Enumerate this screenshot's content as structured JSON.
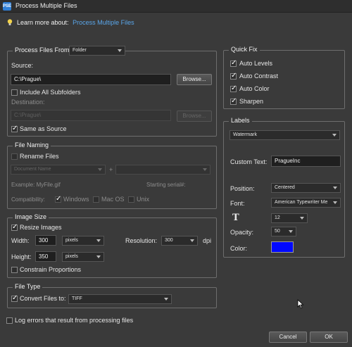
{
  "window": {
    "title": "Process Multiple Files",
    "app_icon_text": "PSE"
  },
  "learn_more": {
    "prefix": "Learn more about:",
    "link": "Process Multiple Files"
  },
  "process_from": {
    "legend": "Process Files From:",
    "value": "Folder",
    "source_label": "Source:",
    "source_path": "C:\\Prague\\",
    "browse_label": "Browse...",
    "include_subfolders": "Include All Subfolders",
    "destination_label": "Destination:",
    "destination_path": "C:\\Prague\\",
    "browse2_label": "Browse...",
    "same_as_source": "Same as Source"
  },
  "file_naming": {
    "legend": "File Naming",
    "rename_files": "Rename Files",
    "naming_value": "Document Name",
    "plus": "+",
    "example": "Example: MyFile.gif",
    "serial_label": "Starting serial#:",
    "compat_label": "Compatibility:",
    "windows": "Windows",
    "macos": "Mac OS",
    "unix": "Unix"
  },
  "image_size": {
    "legend": "Image Size",
    "resize": "Resize Images",
    "width_label": "Width:",
    "width_value": "300",
    "width_unit": "pixels",
    "height_label": "Height:",
    "height_value": "350",
    "height_unit": "pixels",
    "resolution_label": "Resolution:",
    "resolution_value": "300",
    "resolution_unit": "dpi",
    "constrain": "Constrain Proportions"
  },
  "file_type": {
    "legend": "File Type",
    "convert": "Convert Files to:",
    "format": "TIFF"
  },
  "log_errors": "Log errors that result from processing files",
  "quick_fix": {
    "legend": "Quick Fix",
    "items": [
      "Auto Levels",
      "Auto Contrast",
      "Auto Color",
      "Sharpen"
    ]
  },
  "labels": {
    "legend": "Labels",
    "type": "Watermark",
    "custom_text_label": "Custom Text:",
    "custom_text_value": "PragueInc",
    "position_label": "Position:",
    "position_value": "Centered",
    "font_label": "Font:",
    "font_value": "American Typewriter Me",
    "font_size_icon": "T",
    "font_size_value": "12",
    "opacity_label": "Opacity:",
    "opacity_value": "50",
    "color_label": "Color:",
    "color_value": "#0008ff"
  },
  "buttons": {
    "cancel": "Cancel",
    "ok": "OK"
  }
}
